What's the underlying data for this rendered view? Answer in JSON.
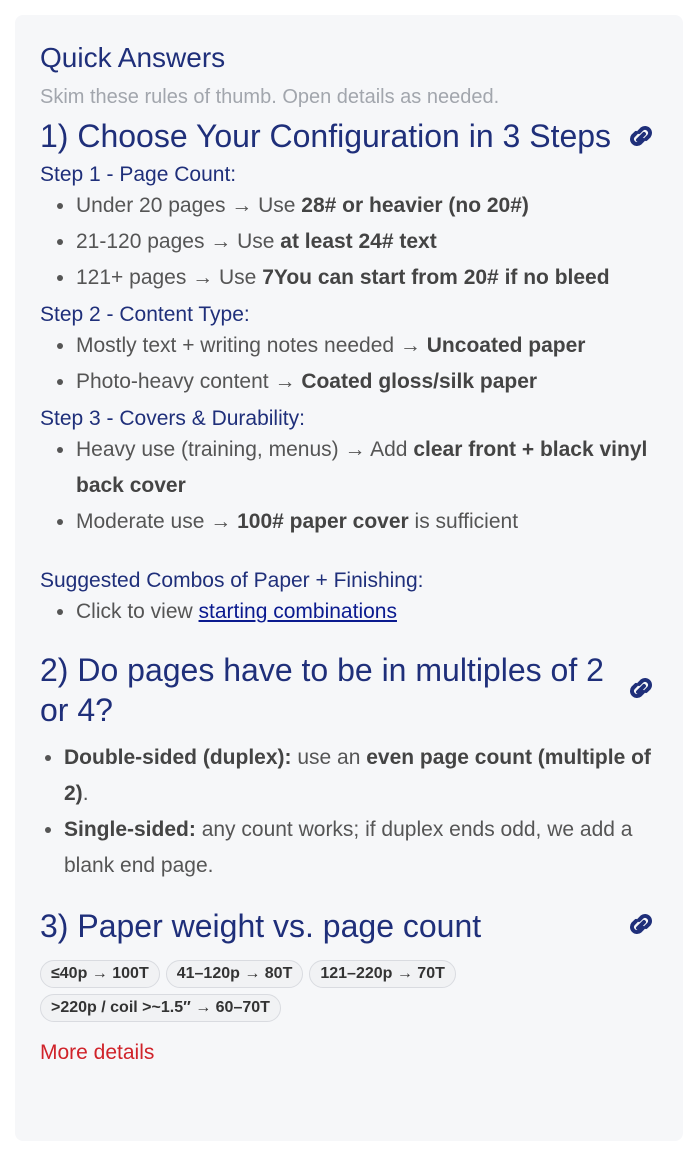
{
  "header": {
    "title": "Quick Answers",
    "subtitle": "Skim these rules of thumb. Open details as needed."
  },
  "section1": {
    "heading": "1) Choose Your Configuration in 3 Steps",
    "link_icon": "link-icon",
    "step1": {
      "label": "Step 1 - Page Count:",
      "items": [
        {
          "pre": "Under 20 pages → Use ",
          "bold": " 28# or heavier (no 20#)"
        },
        {
          "pre": "21-120 pages → Use ",
          "bold": "at least 24# text"
        },
        {
          "pre": "121+ pages → Use ",
          "bold": "7You can start from 20# if no bleed"
        }
      ]
    },
    "step2": {
      "label": "Step 2 - Content Type:",
      "items": [
        {
          "pre": "Mostly text + writing notes needed → ",
          "bold": "Uncoated paper"
        },
        {
          "pre": "Photo-heavy content → ",
          "bold": "Coated gloss/silk paper"
        }
      ]
    },
    "step3": {
      "label": "Step 3 - Covers & Durability:",
      "items": [
        {
          "pre": "Heavy use (training, menus) → Add ",
          "bold": "clear front + black vinyl back cover",
          "post": ""
        },
        {
          "pre": "Moderate use → ",
          "bold": "100# paper cover",
          "post": " is sufficient"
        }
      ]
    },
    "combos": {
      "label": "Suggested Combos of Paper + Finishing:",
      "pre": "Click to view ",
      "link": "starting combinations"
    }
  },
  "section2": {
    "heading": "2) Do pages have to be in multiples of 2 or 4?",
    "items": [
      {
        "bold1": "Double-sided (duplex):",
        "mid": " use an ",
        "bold2": "even page count (multiple of 2)",
        "post": "."
      },
      {
        "bold1": "Single-sided:",
        "mid": " any count works; if duplex ends odd, we add a blank end page.",
        "bold2": "",
        "post": ""
      }
    ]
  },
  "section3": {
    "heading": "3) Paper weight vs. page count",
    "chips": [
      "≤40p → 100T",
      "41–120p → 80T",
      "121–220p → 70T",
      ">220p / coil >~1.5″ → 60–70T"
    ],
    "more_details": "More details"
  },
  "colors": {
    "heading": "#1f2f7a",
    "body_text": "#555555",
    "muted": "#a2a6ad",
    "link": "#0a1a8f",
    "more_details": "#d0232a",
    "card_bg": "#f6f7f9"
  }
}
